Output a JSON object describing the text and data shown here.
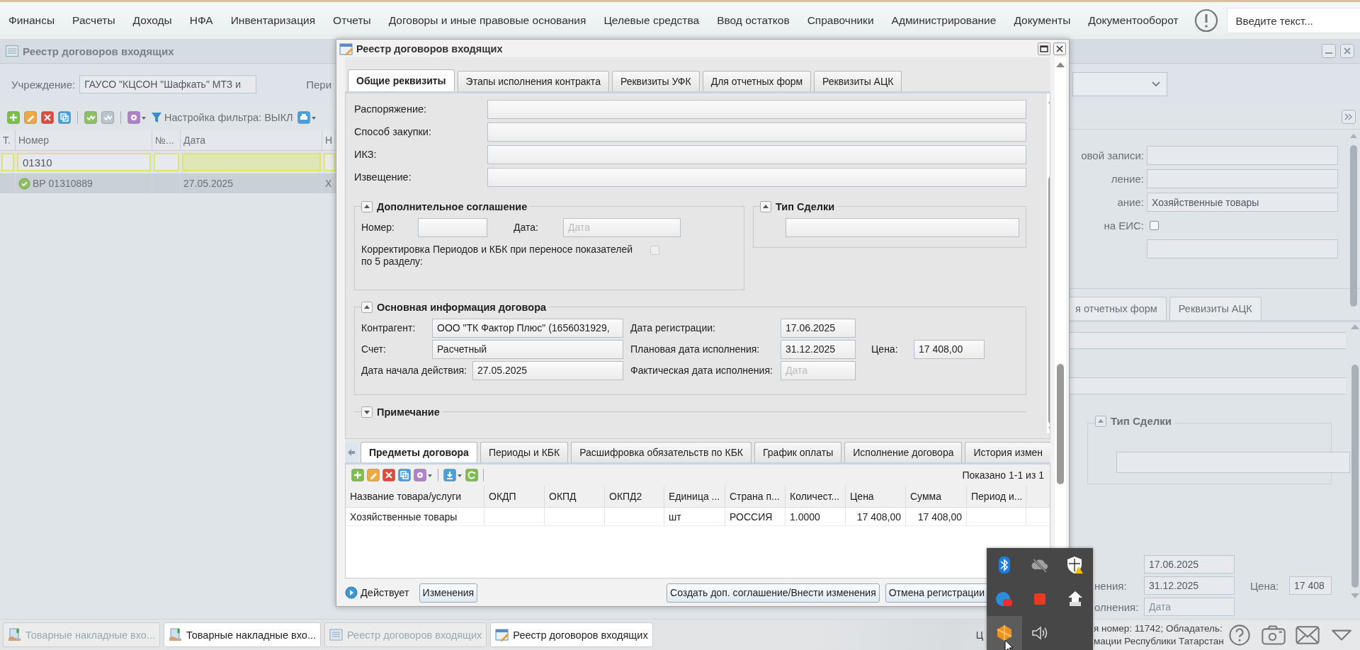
{
  "menu": {
    "items": [
      "Финансы",
      "Расчеты",
      "Доходы",
      "НФА",
      "Инвентаризация",
      "Отчеты",
      "Договоры и иные правовые основания",
      "Целевые средства",
      "Ввод остатков",
      "Справочники",
      "Администрирование",
      "Документы",
      "Документооборот"
    ],
    "search": {
      "placeholder": "Введите текст..."
    }
  },
  "background_window": {
    "title": "Реестр договоров входящих",
    "institution_label": "Учреждение:",
    "institution_value": "ГАУСО \"КЦСОН \"Шафкать\" МТЗ и",
    "period_label": "Пери",
    "filter_button": "Настройка фильтра: ВЫКЛ",
    "grid": {
      "columns": [
        "Т.",
        "Номер",
        "№...",
        "Дата",
        "Н"
      ],
      "filter_value": "01310",
      "rows": [
        {
          "selected": true,
          "cells": [
            "",
            "ВР 01310889",
            "",
            "27.05.2025",
            "Х"
          ]
        }
      ]
    },
    "detail": {
      "fields": [
        {
          "label": "овой записи:"
        },
        {
          "label": "ление:"
        },
        {
          "label": "ание:",
          "value": "Хозяйственные товары"
        }
      ],
      "eis_label": "на ЕИС:",
      "eis_checked": false,
      "tabs": [
        {
          "label": "я отчетных форм",
          "selected": false
        },
        {
          "label": "Реквизиты АЦК",
          "selected": false
        }
      ],
      "deal_type_title": "Тип Сделки",
      "dates": [
        {
          "value": "17.06.2025"
        },
        {
          "label": "нения:",
          "value": "31.12.2025",
          "extra_label": "Цена:",
          "extra_value": "17 408"
        },
        {
          "label": "олнения:",
          "placeholder": "Дата"
        }
      ]
    }
  },
  "dialog": {
    "title": "Реестр договоров входящих",
    "tabs": [
      {
        "label": "Общие реквизиты",
        "selected": true
      },
      {
        "label": "Этапы исполнения контракта",
        "selected": false
      },
      {
        "label": "Реквизиты УФК",
        "selected": false
      },
      {
        "label": "Для отчетных форм",
        "selected": false
      },
      {
        "label": "Реквизиты АЦК",
        "selected": false
      }
    ],
    "rows": [
      {
        "label": "Распоряжение:",
        "value": ""
      },
      {
        "label": "Способ закупки:",
        "value": ""
      },
      {
        "label": "ИКЗ:",
        "value": ""
      },
      {
        "label": "Извещение:",
        "value": ""
      }
    ],
    "additional": {
      "title": "Дополнительное соглашение",
      "expanded": true,
      "number_label": "Номер:",
      "date_label": "Дата:",
      "date_placeholder": "Дата",
      "correction_label": "Корректировка Периодов и КБК при переносе показателей по 5 разделу:",
      "correction_checked": false
    },
    "deal_type": {
      "title": "Тип Сделки",
      "expanded": true
    },
    "main_info": {
      "title": "Основная информация договора",
      "expanded": true,
      "rows": [
        {
          "left": {
            "label": "Контрагент:",
            "value": "ООО \"ТК Фактор Плюс\" (1656031929,"
          },
          "middle": {
            "label": "Дата регистрации:",
            "value": "17.06.2025"
          }
        },
        {
          "left": {
            "label": "Счет:",
            "value": "Расчетный"
          },
          "middle": {
            "label": "Плановая дата исполнения:",
            "value": "31.12.2025"
          },
          "right": {
            "label": "Цена:",
            "value": "17 408,00"
          }
        },
        {
          "left": {
            "label": "Дата начала действия:",
            "value": "27.05.2025"
          },
          "middle": {
            "label": "Фактическая дата исполнения:",
            "placeholder": "Дата"
          }
        }
      ]
    },
    "note": {
      "title": "Примечание",
      "expanded": false
    },
    "bottom_tabs": [
      {
        "label": "Предметы договора",
        "selected": true
      },
      {
        "label": "Периоды и КБК",
        "selected": false
      },
      {
        "label": "Расшифровка обязательств по КБК",
        "selected": false
      },
      {
        "label": "График оплаты",
        "selected": false
      },
      {
        "label": "Исполнение договора",
        "selected": false
      },
      {
        "label": "История измен",
        "selected": false
      }
    ],
    "grid": {
      "shown": "Показано 1-1 из 1",
      "columns": [
        "Название товара/услуги",
        "ОКДП",
        "ОКПД",
        "ОКПД2",
        "Единица ...",
        "Страна п...",
        "Количест...",
        "Цена",
        "Сумма",
        "Период и..."
      ],
      "rows": [
        [
          "Хозяйственные товары",
          "",
          "",
          "",
          "шт",
          "РОССИЯ",
          "1.0000",
          "17 408,00",
          "17 408,00",
          ""
        ]
      ]
    },
    "footer": {
      "status": "Действует",
      "buttons": [
        "Изменения",
        "Создать доп. соглашение/Внести изменения",
        "Отмена регистрации"
      ]
    }
  },
  "taskbar": {
    "tabs": [
      {
        "label": "Товарные накладные вхо...",
        "kind": "invoice",
        "disabled": true
      },
      {
        "label": "Товарные накладные вхо...",
        "kind": "invoice",
        "disabled": false
      },
      {
        "label": "Реестр договоров входящих",
        "kind": "list",
        "disabled": true
      },
      {
        "label": "Реестр договоров входящих",
        "kind": "edit",
        "disabled": false
      }
    ],
    "status_cut": "Ц",
    "status_lines": [
      "я номер: 11742; Обладатель:",
      "мации Республики Татарстан"
    ]
  }
}
